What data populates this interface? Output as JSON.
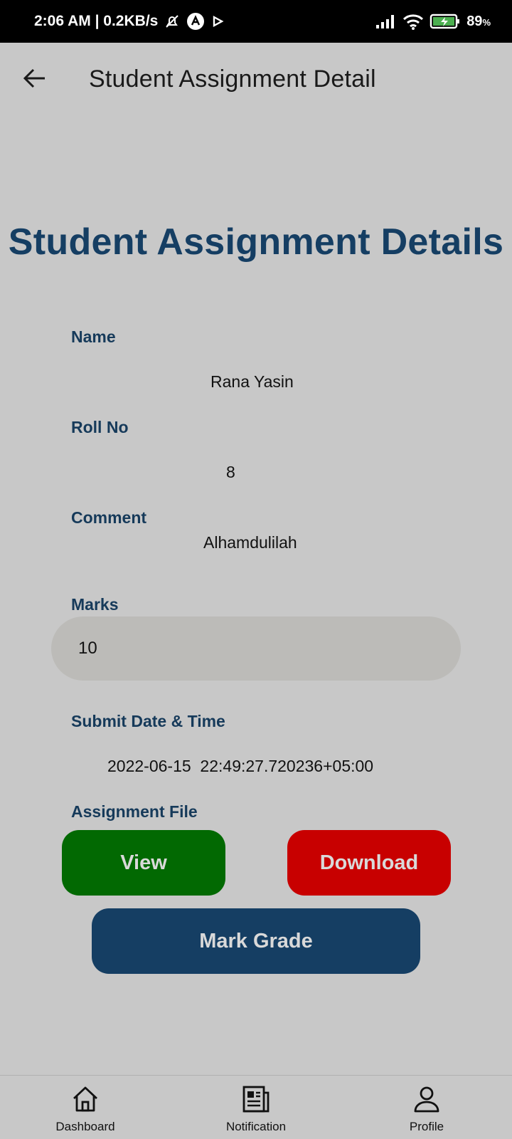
{
  "status_bar": {
    "time_speed": "2:06 AM | 0.2KB/s",
    "battery_percent": "89",
    "battery_unit": "%",
    "icons": [
      "mute-icon",
      "app-a-icon",
      "play-icon",
      "signal-icon",
      "wifi-icon",
      "battery-charging-icon"
    ]
  },
  "app_bar": {
    "title": "Student Assignment Detail"
  },
  "page": {
    "heading": "Student Assignment Details"
  },
  "details": {
    "name_label": "Name",
    "name_value": "Rana Yasin",
    "roll_label": "Roll No",
    "roll_value": "8",
    "comment_label": "Comment",
    "comment_value": "Alhamdulilah",
    "marks_label": "Marks",
    "marks_value": "10",
    "submit_label": "Submit Date & Time",
    "submit_value": "2022-06-15  22:49:27.720236+05:00",
    "file_label": "Assignment File"
  },
  "buttons": {
    "view": "View",
    "download": "Download",
    "mark_grade": "Mark Grade"
  },
  "bottom_nav": {
    "items": [
      {
        "label": "Dashboard",
        "icon": "home-icon"
      },
      {
        "label": "Notification",
        "icon": "newspaper-icon"
      },
      {
        "label": "Profile",
        "icon": "person-icon"
      }
    ]
  },
  "colors": {
    "background": "#c8c8c8",
    "heading": "#153e63",
    "label": "#163a5a",
    "view_button": "#026902",
    "download_button": "#c80000",
    "grade_button": "#153e63",
    "input_fill": "#bcbbb8"
  }
}
